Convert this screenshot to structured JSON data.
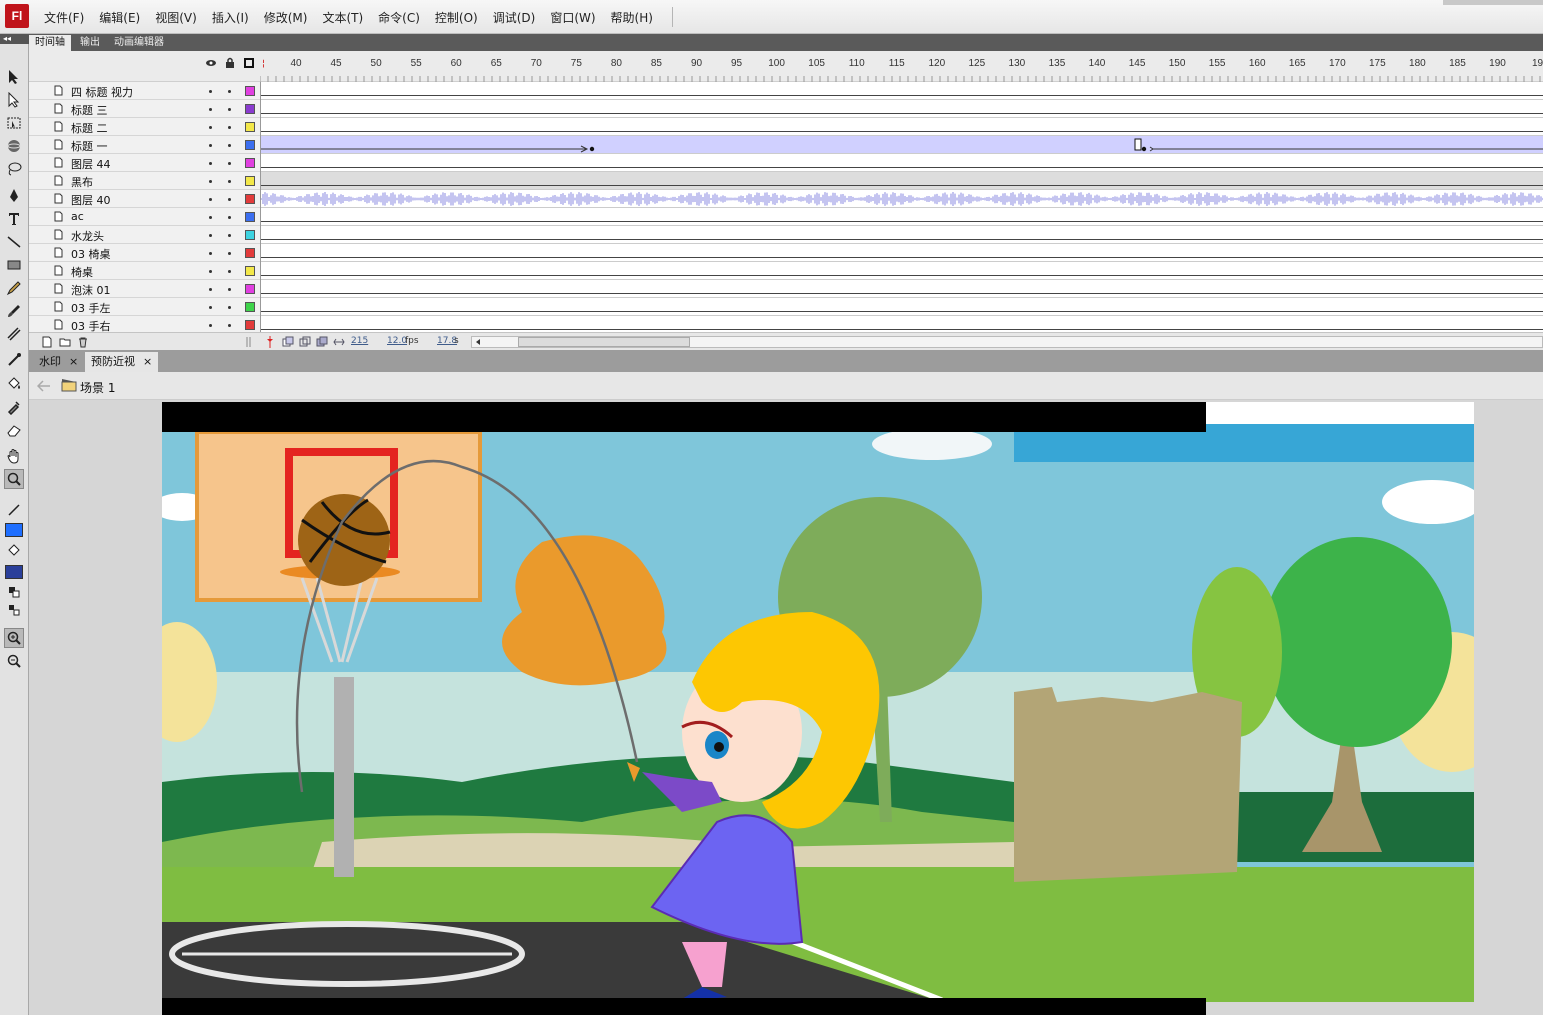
{
  "app": {
    "logo": "Fl"
  },
  "menu": [
    "文件(F)",
    "编辑(E)",
    "视图(V)",
    "插入(I)",
    "修改(M)",
    "文本(T)",
    "命令(C)",
    "控制(O)",
    "调试(D)",
    "窗口(W)",
    "帮助(H)"
  ],
  "timeline": {
    "tabs": [
      "时间轴",
      "输出",
      "动画编辑器"
    ],
    "frame_numbers": [
      "40",
      "45",
      "50",
      "55",
      "60",
      "65",
      "70",
      "75",
      "80",
      "85",
      "90",
      "95",
      "100",
      "105",
      "110",
      "115",
      "120",
      "125",
      "130",
      "135",
      "140",
      "145",
      "150",
      "155",
      "160",
      "165",
      "170",
      "175",
      "180",
      "185",
      "190",
      "19"
    ],
    "layers": [
      {
        "name": "四 标题 视力",
        "color": "#e040e0"
      },
      {
        "name": "标题 三",
        "color": "#8a3ccf"
      },
      {
        "name": "标题 二",
        "color": "#f3e84a"
      },
      {
        "name": "标题 一",
        "color": "#3b6ef0"
      },
      {
        "name": "图层 44",
        "color": "#e040e0"
      },
      {
        "name": "黑布",
        "color": "#f3e84a"
      },
      {
        "name": "图层 40",
        "color": "#e23b3b"
      },
      {
        "name": "ac",
        "color": "#3b6ef0"
      },
      {
        "name": "水龙头",
        "color": "#3ed3e0"
      },
      {
        "name": "03 椅桌",
        "color": "#e23b3b"
      },
      {
        "name": "椅桌",
        "color": "#f3e84a"
      },
      {
        "name": "泡沫 01",
        "color": "#e040e0"
      },
      {
        "name": "03 手左",
        "color": "#3ed34a"
      },
      {
        "name": "03 手右",
        "color": "#e23b3b"
      }
    ],
    "footer": {
      "frame": "215",
      "fps": "12.0",
      "fps_unit": "fps",
      "time": "17.8",
      "time_unit": "s"
    }
  },
  "doc_tabs": [
    {
      "label": "水印",
      "close": "×"
    },
    {
      "label": "预防近视",
      "close": "×"
    }
  ],
  "scene": {
    "label": "场景 1"
  },
  "colors": {
    "stroke": "#111111",
    "fill": "#1f6fff",
    "fill2": "#2a3f9a"
  }
}
